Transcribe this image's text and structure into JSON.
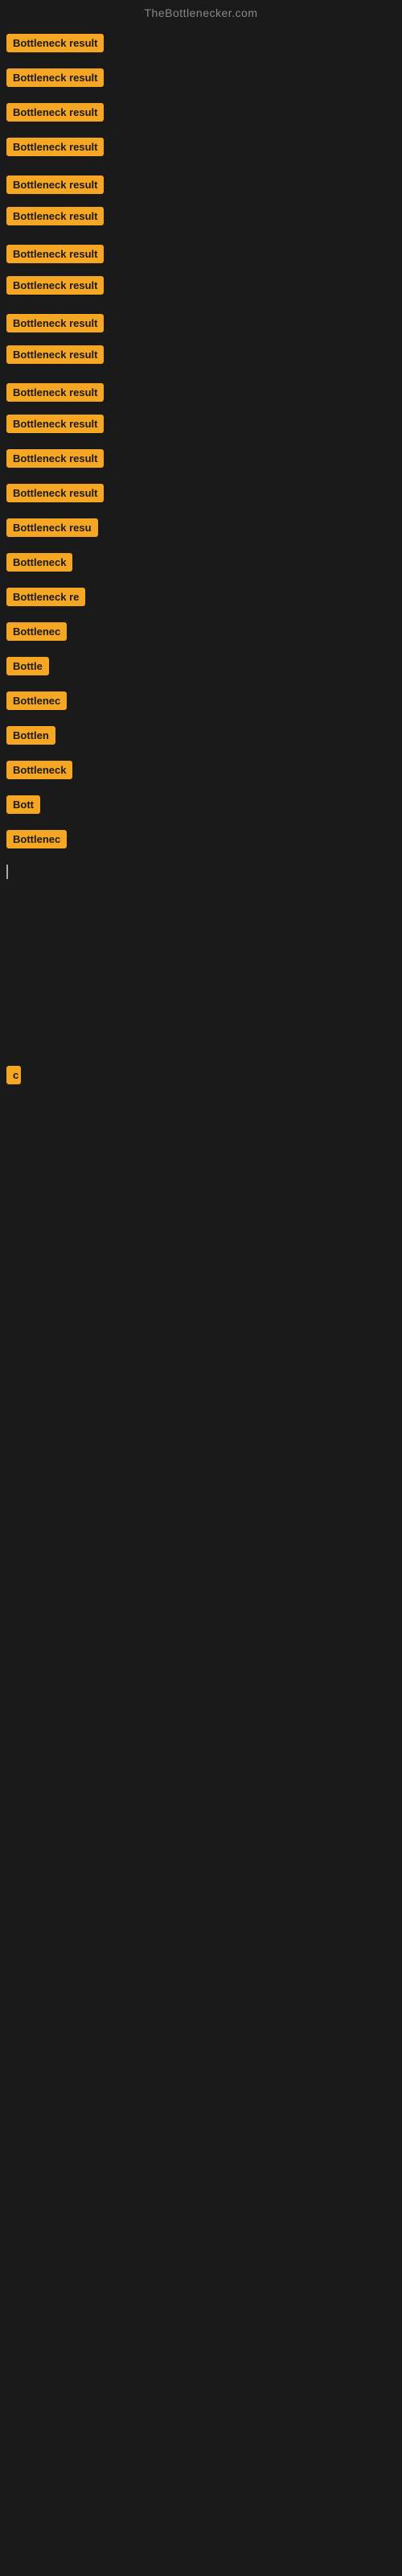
{
  "header": {
    "title": "TheBottlenecker.com"
  },
  "badge_label": "Bottleneck result",
  "rows": [
    {
      "id": 1,
      "label": "Bottleneck result",
      "width": 175
    },
    {
      "id": 2,
      "label": "Bottleneck result",
      "width": 175
    },
    {
      "id": 3,
      "label": "Bottleneck result",
      "width": 175
    },
    {
      "id": 4,
      "label": "Bottleneck result",
      "width": 175
    },
    {
      "id": 5,
      "label": "Bottleneck result",
      "width": 175
    },
    {
      "id": 6,
      "label": "Bottleneck result",
      "width": 175
    },
    {
      "id": 7,
      "label": "Bottleneck result",
      "width": 175
    },
    {
      "id": 8,
      "label": "Bottleneck result",
      "width": 175
    },
    {
      "id": 9,
      "label": "Bottleneck result",
      "width": 175
    },
    {
      "id": 10,
      "label": "Bottleneck result",
      "width": 175
    },
    {
      "id": 11,
      "label": "Bottleneck result",
      "width": 175
    },
    {
      "id": 12,
      "label": "Bottleneck result",
      "width": 175
    },
    {
      "id": 13,
      "label": "Bottleneck result",
      "width": 175
    },
    {
      "id": 14,
      "label": "Bottleneck result",
      "width": 175
    },
    {
      "id": 15,
      "label": "Bottleneck resu",
      "width": 148
    },
    {
      "id": 16,
      "label": "Bottleneck",
      "width": 90
    },
    {
      "id": 17,
      "label": "Bottleneck re",
      "width": 118
    },
    {
      "id": 18,
      "label": "Bottlenec",
      "width": 84
    },
    {
      "id": 19,
      "label": "Bottle",
      "width": 60
    },
    {
      "id": 20,
      "label": "Bottlenec",
      "width": 84
    },
    {
      "id": 21,
      "label": "Bottlen",
      "width": 70
    },
    {
      "id": 22,
      "label": "Bottleneck",
      "width": 90
    },
    {
      "id": 23,
      "label": "Bott",
      "width": 50
    },
    {
      "id": 24,
      "label": "Bottlenec",
      "width": 84
    }
  ],
  "cursor": {
    "visible": true
  },
  "bottom_item": {
    "label": "c",
    "visible": true
  }
}
